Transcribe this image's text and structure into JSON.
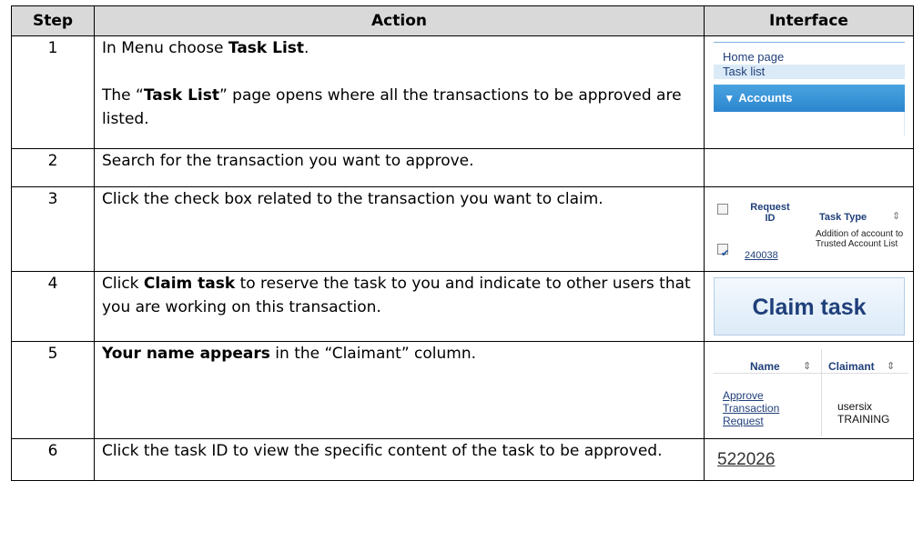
{
  "headers": {
    "step": "Step",
    "action": "Action",
    "interface": "Interface"
  },
  "rows": [
    {
      "step": "1",
      "action_a_pre": "In Menu choose ",
      "action_a_bold": "Task List",
      "action_a_post": ".",
      "action_b_pre": "The “",
      "action_b_bold": "Task List",
      "action_b_post": "” page opens where all the transactions to be approved are listed.",
      "ui": {
        "home": "Home page",
        "tasklist": "Task list",
        "accounts": "Accounts"
      }
    },
    {
      "step": "2",
      "action": "Search for the transaction you want to approve."
    },
    {
      "step": "3",
      "action": "Click the check box related to the transaction you want to claim.",
      "ui": {
        "col1": "Request ID",
        "col2": "Task Type",
        "id": "240038",
        "type": "Addition of account to Trusted Account List"
      }
    },
    {
      "step": "4",
      "action_pre": "Click ",
      "action_bold": "Claim task",
      "action_post": " to reserve the task to you and indicate to other users that you are working on this transaction.",
      "ui": {
        "button": "Claim task"
      }
    },
    {
      "step": "5",
      "action_bold": "Your name appears",
      "action_post": " in the “Claimant” column.",
      "ui": {
        "col1": "Name",
        "col2": "Claimant",
        "task": "Approve Transaction Request",
        "user": "usersix TRAINING"
      }
    },
    {
      "step": "6",
      "action": "Click the task ID to view the specific content of the task to be approved.",
      "ui": {
        "taskid": "522026"
      }
    }
  ]
}
